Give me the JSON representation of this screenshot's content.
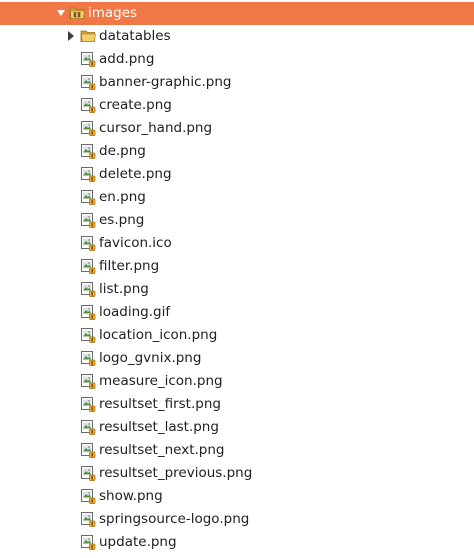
{
  "tree": {
    "folder": {
      "name": "images",
      "expanded": true,
      "selected": true,
      "icon": "package-folder-icon"
    },
    "subfolders": [
      {
        "name": "datatables",
        "expanded": false,
        "icon": "folder-icon"
      }
    ],
    "files": [
      {
        "name": "add.png",
        "icon": "image-file-icon"
      },
      {
        "name": "banner-graphic.png",
        "icon": "image-file-icon"
      },
      {
        "name": "create.png",
        "icon": "image-file-icon"
      },
      {
        "name": "cursor_hand.png",
        "icon": "image-file-icon"
      },
      {
        "name": "de.png",
        "icon": "image-file-icon"
      },
      {
        "name": "delete.png",
        "icon": "image-file-icon"
      },
      {
        "name": "en.png",
        "icon": "image-file-icon"
      },
      {
        "name": "es.png",
        "icon": "image-file-icon"
      },
      {
        "name": "favicon.ico",
        "icon": "image-file-icon"
      },
      {
        "name": "filter.png",
        "icon": "image-file-icon"
      },
      {
        "name": "list.png",
        "icon": "image-file-icon"
      },
      {
        "name": "loading.gif",
        "icon": "image-file-icon"
      },
      {
        "name": "location_icon.png",
        "icon": "image-file-icon"
      },
      {
        "name": "logo_gvnix.png",
        "icon": "image-file-icon"
      },
      {
        "name": "measure_icon.png",
        "icon": "image-file-icon"
      },
      {
        "name": "resultset_first.png",
        "icon": "image-file-icon"
      },
      {
        "name": "resultset_last.png",
        "icon": "image-file-icon"
      },
      {
        "name": "resultset_next.png",
        "icon": "image-file-icon"
      },
      {
        "name": "resultset_previous.png",
        "icon": "image-file-icon"
      },
      {
        "name": "show.png",
        "icon": "image-file-icon"
      },
      {
        "name": "springsource-logo.png",
        "icon": "image-file-icon"
      },
      {
        "name": "update.png",
        "icon": "image-file-icon"
      }
    ]
  },
  "colors": {
    "selection": "#f07746",
    "folder": "#e8b84a",
    "text": "#1f1f1f"
  }
}
